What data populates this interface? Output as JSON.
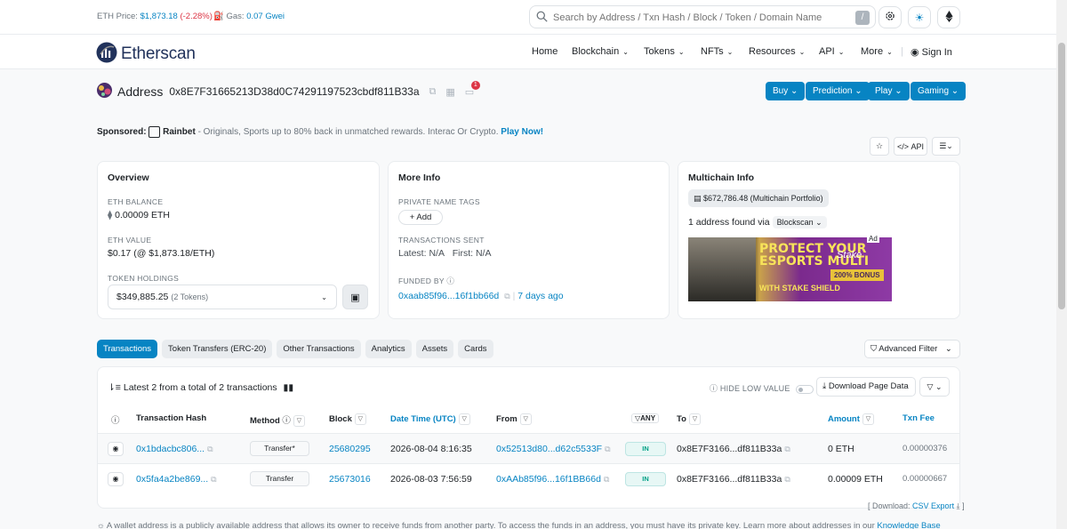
{
  "topbar": {
    "eth_price_label": "ETH Price:",
    "eth_price": "$1,873.18",
    "eth_change": "(-2.28%)",
    "gas_label": "Gas:",
    "gas_value": "0.07 Gwei",
    "search_placeholder": "Search by Address / Txn Hash / Block / Token / Domain Name",
    "search_shortcut": "/"
  },
  "nav": {
    "logo": "Etherscan",
    "items": [
      "Home",
      "Blockchain",
      "Tokens",
      "NFTs",
      "Resources",
      "API",
      "More"
    ],
    "sign_in": "Sign In"
  },
  "address": {
    "label": "Address",
    "hash": "0x8E7F31665213D38d0C74291197523cbdf811B33a",
    "notification_count": "1"
  },
  "header_buttons": [
    "Buy",
    "Prediction",
    "Play",
    "Gaming"
  ],
  "sponsor": {
    "prefix": "Sponsored:",
    "name": "Rainbet",
    "text": " - Originals, Sports up to 80% back in unmatched rewards. Interac Or Crypto.",
    "cta": "Play Now!"
  },
  "api_label": "API",
  "overview": {
    "title": "Overview",
    "eth_balance_label": "ETH BALANCE",
    "eth_balance": "0.00009 ETH",
    "eth_value_label": "ETH VALUE",
    "eth_value": "$0.17 (@ $1,873.18/ETH)",
    "token_holdings_label": "TOKEN HOLDINGS",
    "token_holdings_value": "$349,885.25",
    "token_holdings_count": "(2 Tokens)"
  },
  "more_info": {
    "title": "More Info",
    "private_tags_label": "PRIVATE NAME TAGS",
    "add_label": "+ Add",
    "tx_sent_label": "TRANSACTIONS SENT",
    "latest": "Latest: N/A",
    "first": "First: N/A",
    "funded_by_label": "FUNDED BY",
    "funded_by_addr": "0xaab85f96...16f1bb66d",
    "funded_by_time": "7 days ago"
  },
  "multichain": {
    "title": "Multichain Info",
    "portfolio": "$672,786.48 (Multichain Portfolio)",
    "found_text": "1 address found via",
    "source": "Blockscan",
    "ad_label": "Ad",
    "ad_line1": "PROTECT YOUR",
    "ad_line2": "ESPORTS MULTI",
    "ad_line3": "WITH STAKE SHIELD",
    "ad_brand": "Stake",
    "ad_bonus": "200% BONUS"
  },
  "tabs": [
    "Transactions",
    "Token Transfers (ERC-20)",
    "Other Transactions",
    "Analytics",
    "Assets",
    "Cards"
  ],
  "advanced_filter": "Advanced Filter",
  "txn_table": {
    "summary": "Latest 2 from a total of 2 transactions",
    "hide_low_value": "HIDE LOW VALUE",
    "download": "Download Page Data",
    "headers": {
      "hash": "Transaction Hash",
      "method": "Method",
      "block": "Block",
      "datetime": "Date Time (UTC)",
      "from": "From",
      "any": "ANY",
      "to": "To",
      "amount": "Amount",
      "fee": "Txn Fee"
    },
    "rows": [
      {
        "hash": "0x1bdacbc806...",
        "method": "Transfer*",
        "block": "25680295",
        "datetime": "2026-08-04 8:16:35",
        "from": "0x52513d80...d62c5533F",
        "direction": "IN",
        "to": "0x8E7F3166...df811B33a",
        "amount": "0 ETH",
        "fee": "0.00000376"
      },
      {
        "hash": "0x5fa4a2be869...",
        "method": "Transfer",
        "block": "25673016",
        "datetime": "2026-08-03 7:56:59",
        "from": "0xAAb85f96...16f1BB66d",
        "direction": "IN",
        "to": "0x8E7F3166...df811B33a",
        "amount": "0.00009 ETH",
        "fee": "0.00000667"
      }
    ]
  },
  "csv": {
    "prefix": "[ Download:",
    "link": "CSV Export",
    "suffix": "]"
  },
  "footer_note": {
    "text": "A wallet address is a publicly available address that allows its owner to receive funds from another party. To access the funds in an address, you must have its private key. Learn more about addresses in our",
    "link": "Knowledge Base"
  }
}
